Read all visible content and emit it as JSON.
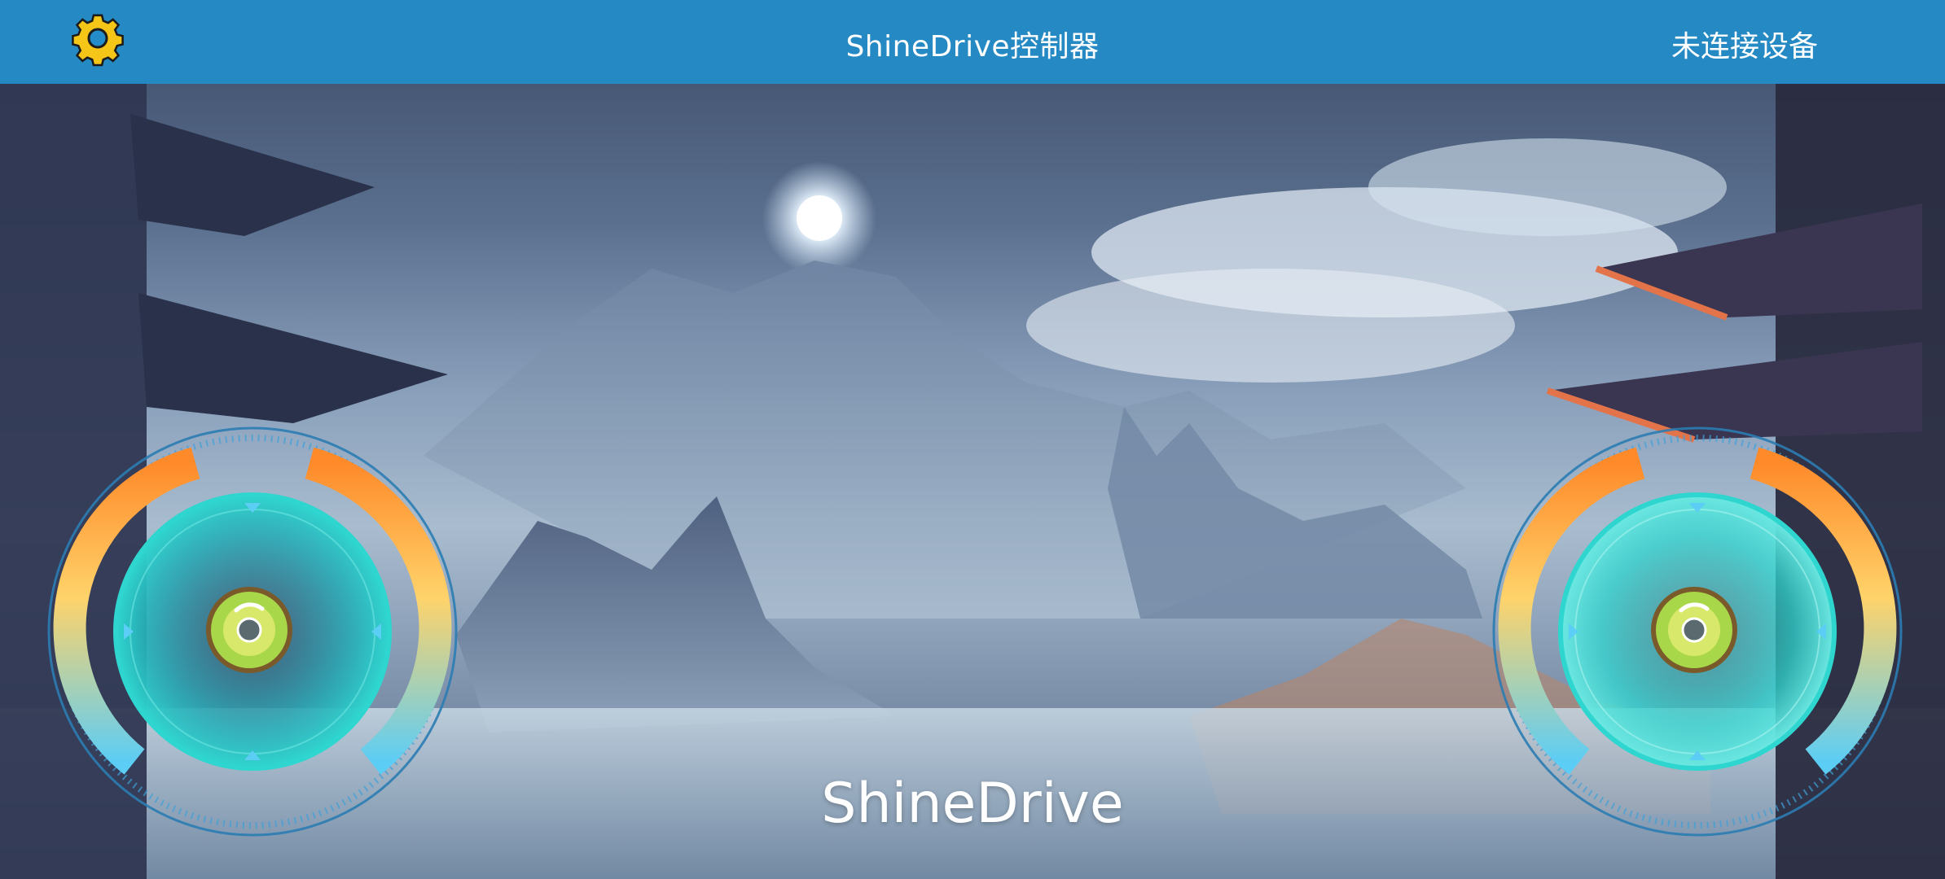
{
  "header": {
    "title": "ShineDrive控制器",
    "connection_status": "未连接设备",
    "settings_icon": "gear-icon"
  },
  "brand": {
    "text": "ShineDrive"
  },
  "joysticks": {
    "left": {
      "icon": "joystick-knob"
    },
    "right": {
      "icon": "joystick-knob"
    }
  },
  "colors": {
    "topbar": "#248cc8",
    "gear": "#f5c518",
    "arc_orange": "#ff8a2a",
    "arc_yellow": "#ffd36a",
    "arc_blue": "#5ccdf5",
    "disc_cyan": "#2fd6d0",
    "knob_green": "#a8d84a"
  }
}
